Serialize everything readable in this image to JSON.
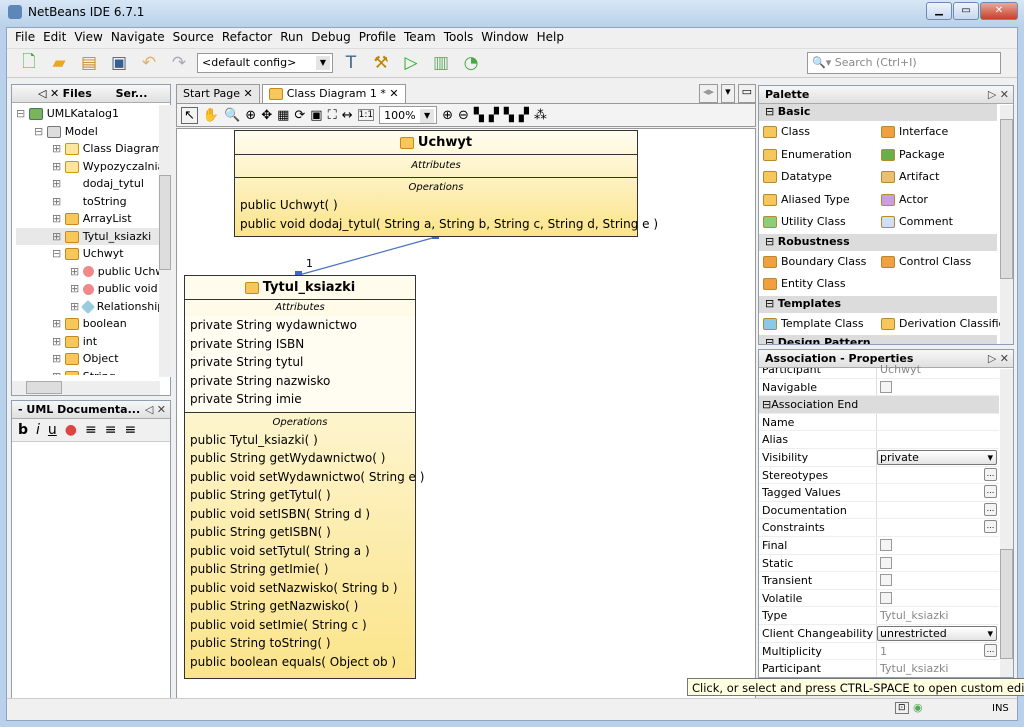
{
  "window": {
    "title": "NetBeans IDE 6.7.1"
  },
  "menu": [
    "File",
    "Edit",
    "View",
    "Navigate",
    "Source",
    "Refactor",
    "Run",
    "Debug",
    "Profile",
    "Team",
    "Tools",
    "Window",
    "Help"
  ],
  "toolbar": {
    "config": "<default config>",
    "search_placeholder": "Search (Ctrl+I)"
  },
  "projects": {
    "tabs": [
      "Files",
      "Ser..."
    ],
    "tree": [
      {
        "label": "UMLKatalog1",
        "level": 0,
        "icon": "project-icon"
      },
      {
        "label": "Model",
        "level": 1,
        "icon": "package-icon"
      },
      {
        "label": "Class Diagram",
        "level": 2,
        "icon": "diagram-icon"
      },
      {
        "label": "Wypozyczalnia",
        "level": 2,
        "icon": "diagram-icon"
      },
      {
        "label": "dodaj_tytul",
        "level": 2,
        "icon": "message-icon"
      },
      {
        "label": "toString",
        "level": 2,
        "icon": "message-icon"
      },
      {
        "label": "ArrayList",
        "level": 2,
        "icon": "class-icon"
      },
      {
        "label": "Tytul_ksiazki",
        "level": 2,
        "icon": "class-icon"
      },
      {
        "label": "Uchwyt",
        "level": 2,
        "icon": "class-icon"
      },
      {
        "label": "public Uchwyt",
        "level": 3,
        "icon": "operation-icon"
      },
      {
        "label": "public void",
        "level": 3,
        "icon": "operation-icon"
      },
      {
        "label": "Relationships",
        "level": 3,
        "icon": "relationship-icon"
      },
      {
        "label": "boolean",
        "level": 2,
        "icon": "datatype-icon"
      },
      {
        "label": "int",
        "level": 2,
        "icon": "datatype-icon"
      },
      {
        "label": "Object",
        "level": 2,
        "icon": "datatype-icon"
      },
      {
        "label": "String",
        "level": 2,
        "icon": "datatype-icon"
      }
    ]
  },
  "uml_doc": {
    "title": "- UML Documenta..."
  },
  "editor": {
    "tabs": [
      "Start Page",
      "Class Diagram 1 *"
    ],
    "zoom": "100%"
  },
  "diagram": {
    "uchwyt": {
      "name": "Uchwyt",
      "attributes_label": "Attributes",
      "operations_label": "Operations",
      "attributes": [],
      "operations": [
        "public Uchwyt(  )",
        "public void  dodaj_tytul( String a, String b, String c, String d, String e )"
      ]
    },
    "tytul": {
      "name": "Tytul_ksiazki",
      "attributes_label": "Attributes",
      "operations_label": "Operations",
      "attributes": [
        "private String wydawnictwo",
        "private String ISBN",
        "private String tytul",
        "private String nazwisko",
        "private String imie"
      ],
      "operations": [
        "public Tytul_ksiazki(  )",
        "public String  getWydawnictwo(  )",
        "public void  setWydawnictwo( String e )",
        "public String  getTytul(  )",
        "public void  setISBN( String d )",
        "public String  getISBN(  )",
        "public void  setTytul( String a )",
        "public String  getImie(  )",
        "public void  setNazwisko( String b )",
        "public String  getNazwisko(  )",
        "public void  setImie( String c )",
        "public String  toString(  )",
        "public boolean  equals( Object ob )"
      ]
    },
    "association_multiplicity": "1"
  },
  "palette": {
    "title": "Palette",
    "categories": [
      {
        "name": "Basic",
        "items": [
          "Class",
          "Interface",
          "Enumeration",
          "Package",
          "Datatype",
          "Artifact",
          "Aliased Type",
          "Actor",
          "Utility Class",
          "Comment"
        ]
      },
      {
        "name": "Robustness",
        "items": [
          "Boundary Class",
          "Control Class",
          "Entity Class"
        ]
      },
      {
        "name": "Templates",
        "items": [
          "Template Class",
          "Derivation Classifier"
        ]
      },
      {
        "name": "Design Pattern",
        "items": []
      }
    ]
  },
  "properties": {
    "title": "Association - Properties",
    "section": "Association End",
    "top": [
      {
        "k": "Participant",
        "v": "Uchwyt",
        "t": "text"
      },
      {
        "k": "Navigable",
        "v": "",
        "t": "check"
      }
    ],
    "rows": [
      {
        "k": "Name",
        "v": "",
        "t": "text"
      },
      {
        "k": "Alias",
        "v": "",
        "t": "text"
      },
      {
        "k": "Visibility",
        "v": "private",
        "t": "select"
      },
      {
        "k": "Stereotypes",
        "v": "",
        "t": "dots"
      },
      {
        "k": "Tagged Values",
        "v": "",
        "t": "dots"
      },
      {
        "k": "Documentation",
        "v": "",
        "t": "dots"
      },
      {
        "k": "Constraints",
        "v": "",
        "t": "dots"
      },
      {
        "k": "Final",
        "v": "",
        "t": "check"
      },
      {
        "k": "Static",
        "v": "",
        "t": "check"
      },
      {
        "k": "Transient",
        "v": "",
        "t": "check"
      },
      {
        "k": "Volatile",
        "v": "",
        "t": "check"
      },
      {
        "k": "Type",
        "v": "Tytul_ksiazki",
        "t": "text"
      },
      {
        "k": "Client Changeability",
        "v": "unrestricted",
        "t": "select"
      },
      {
        "k": "Multiplicity",
        "v": "1",
        "t": "dots"
      },
      {
        "k": "Participant",
        "v": "Tytul_ksiazki",
        "t": "text"
      }
    ]
  },
  "tooltip": "Click, or select and press CTRL-SPACE to open custom editor; right",
  "status": {
    "mode": "INS"
  }
}
